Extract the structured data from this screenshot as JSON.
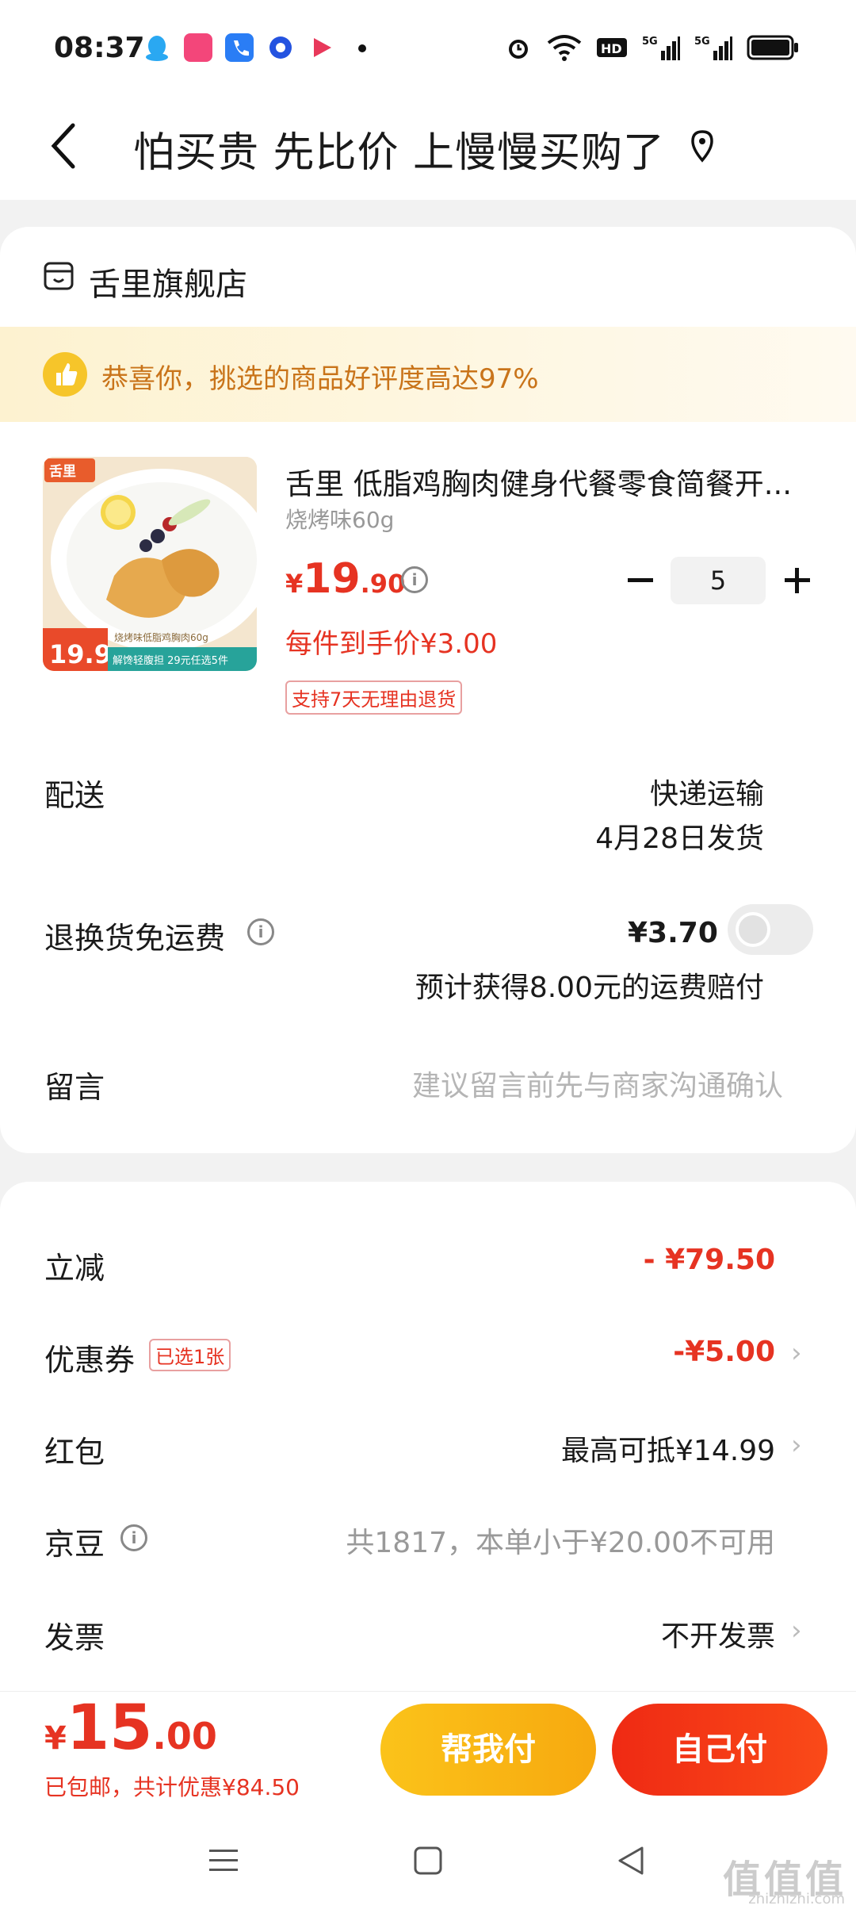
{
  "status_bar": {
    "time": "08:37"
  },
  "header": {
    "title": "怕买贵 先比价 上慢慢买购了"
  },
  "store": {
    "name": "舌里旗舰店"
  },
  "banner": {
    "text": "恭喜你，挑选的商品好评度高达97%"
  },
  "product": {
    "title": "舌里 低脂鸡胸肉健身代餐零食简餐开...",
    "spec": "烧烤味60g",
    "price_symbol": "¥",
    "price_int": "19",
    "price_dec": ".90",
    "unit_price": "每件到手价¥3.00",
    "return_badge": "支持7天无理由退货",
    "quantity": "5",
    "img_brand": "舌里",
    "img_caption": "烧烤味低脂鸡胸肉60g",
    "img_price": "19.9",
    "img_promo": "解馋轻腹担 29元任选5件"
  },
  "delivery": {
    "label": "配送",
    "method": "快递运输",
    "date": "4月28日发货"
  },
  "return_shipping": {
    "label": "退换货免运费",
    "price": "¥3.70",
    "note": "预计获得8.00元的运费赔付",
    "enabled": false
  },
  "message": {
    "label": "留言",
    "placeholder": "建议留言前先与商家沟通确认"
  },
  "discounts": {
    "instant": {
      "label": "立减",
      "value": "- ¥79.50"
    },
    "coupon": {
      "label": "优惠券",
      "tag": "已选1张",
      "value": "-¥5.00"
    },
    "red_packet": {
      "label": "红包",
      "value": "最高可抵¥14.99"
    },
    "jingdou": {
      "label": "京豆",
      "value": "共1817，本单小于¥20.00不可用"
    },
    "invoice": {
      "label": "发票",
      "value": "不开发票"
    }
  },
  "footer": {
    "total_symbol": "¥",
    "total_int": "15",
    "total_dec": ".00",
    "shipping_free": "已包邮",
    "saved": "，共计优惠¥84.50",
    "help_pay": "帮我付",
    "self_pay": "自己付"
  },
  "watermark": {
    "text": "值值值",
    "domain": "zhizhizhi.com"
  },
  "colors": {
    "accent": "#e63322",
    "yellow": "#fbc31a",
    "banner_text": "#c9741a"
  }
}
